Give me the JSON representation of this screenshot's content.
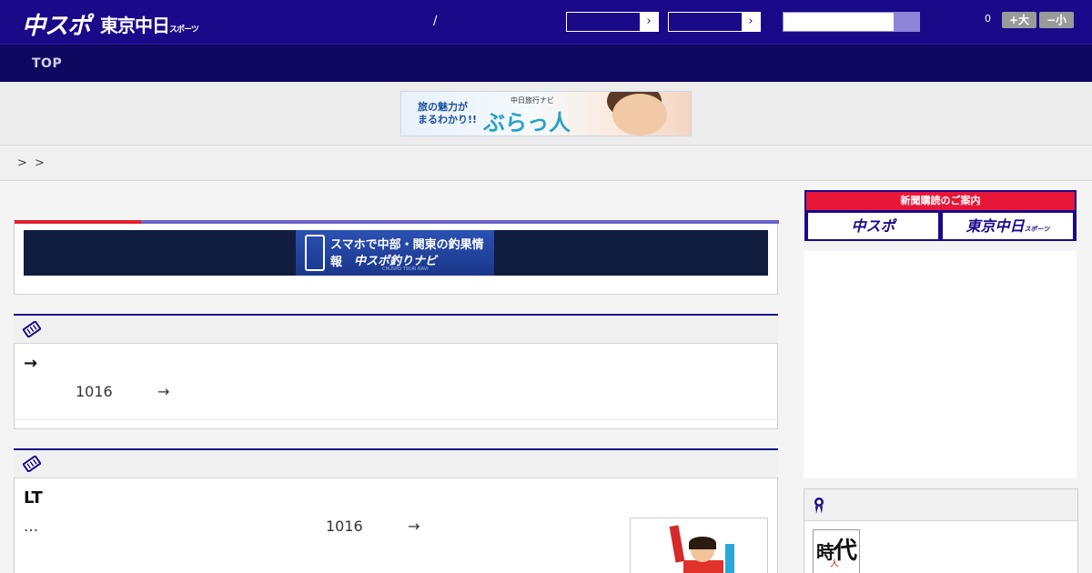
{
  "header": {
    "logo_chuspo": "中スポ",
    "logo_tokyo": "東京中日",
    "logo_tokyo_small": "スポーツ",
    "slash": "/",
    "font_counter": "0",
    "font_up": "+大",
    "font_down": "−小",
    "bg_color": "#1a0a8a"
  },
  "nav": {
    "top_label": "TOP"
  },
  "ad": {
    "left_line1": "旅の魅力が",
    "left_line2": "まるわかり!!",
    "sub": "中日旅行ナビ",
    "main": "ぶらっ人"
  },
  "breadcrumb": {
    "sep1": ">",
    "sep2": ">"
  },
  "banner": {
    "line1": "スマホで中部・関東の釣果情報",
    "line2": "中スポ釣りナビ",
    "line3": "CHUSPO TSURI NAVI"
  },
  "card_a": {
    "title": "→",
    "number": "1016",
    "arrow": "→"
  },
  "card_b": {
    "title": "LT",
    "ellipsis": "…",
    "number": "1016",
    "arrow": "→"
  },
  "sidebar": {
    "subscribe_strip": "新聞購読のご案内",
    "btn_chuspo": "中スポ",
    "btn_tokyo": "東京中日",
    "btn_tokyo_small": "スポーツ",
    "book_k1": "時",
    "book_k2": "代",
    "book_k3": "人"
  },
  "icons": [
    "ticket-icon",
    "medal-icon",
    "chevron-right-icon",
    "search-icon",
    "smartphone-icon"
  ]
}
